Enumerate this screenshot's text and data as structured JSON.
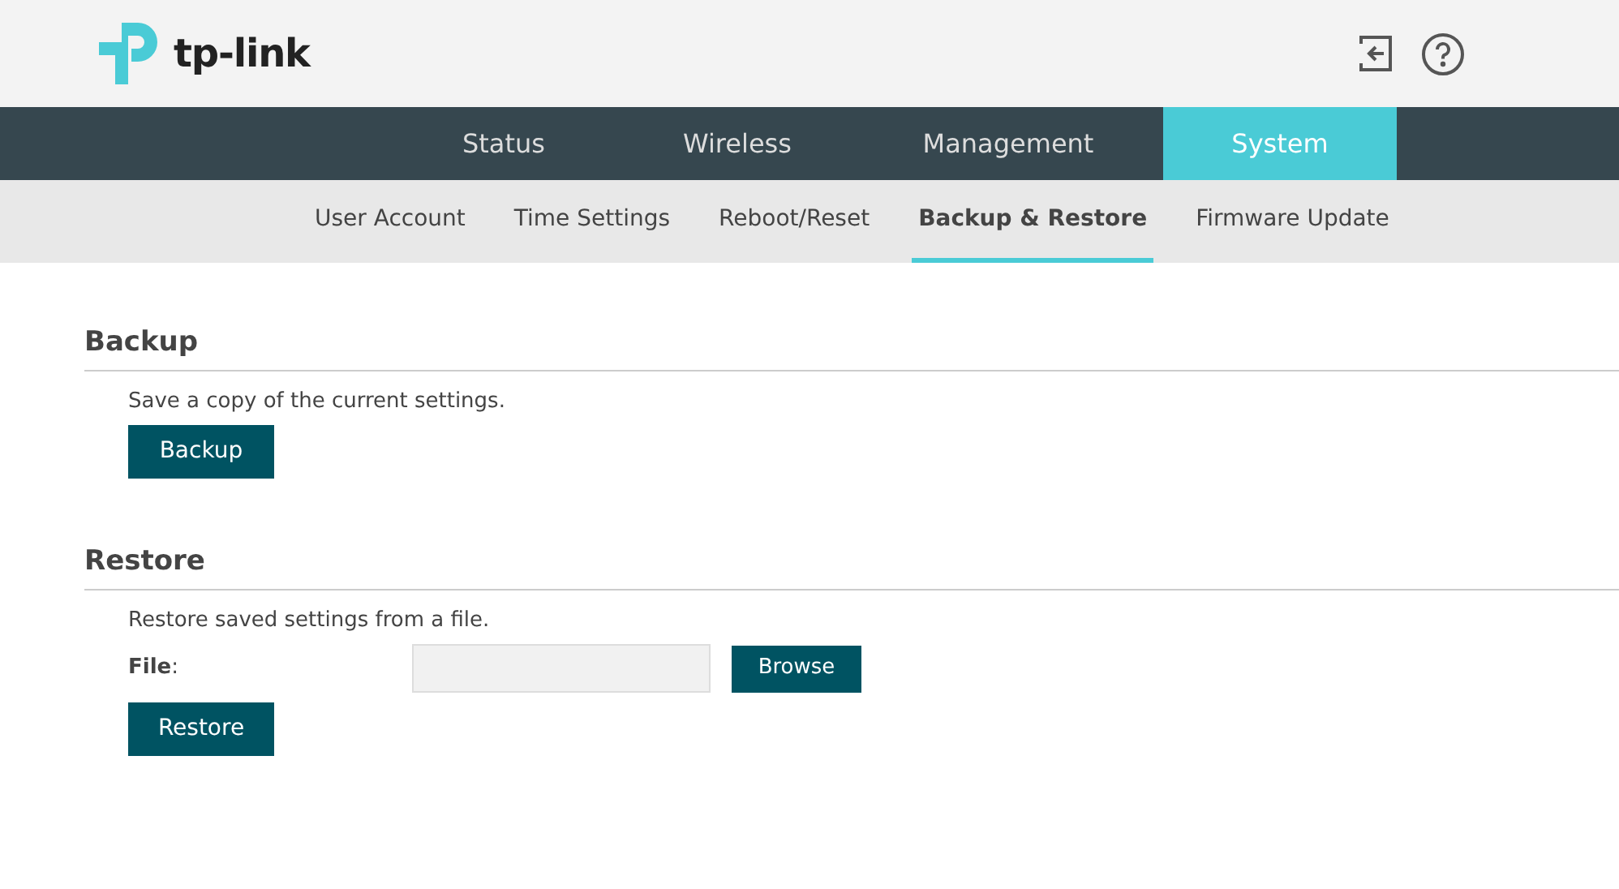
{
  "header": {
    "logo_text": "tp-link"
  },
  "main_nav": [
    {
      "label": "Status",
      "selected": false
    },
    {
      "label": "Wireless",
      "selected": false
    },
    {
      "label": "Management",
      "selected": false
    },
    {
      "label": "System",
      "selected": true
    }
  ],
  "sub_nav": [
    {
      "label": "User Account",
      "selected": false
    },
    {
      "label": "Time Settings",
      "selected": false
    },
    {
      "label": "Reboot/Reset",
      "selected": false
    },
    {
      "label": "Backup & Restore",
      "selected": true
    },
    {
      "label": "Firmware Update",
      "selected": false
    }
  ],
  "backup": {
    "title": "Backup",
    "description": "Save a copy of the current settings.",
    "button": "Backup"
  },
  "restore": {
    "title": "Restore",
    "description": "Restore saved settings from a file.",
    "file_label": "**File**:",
    "browse_button": "Browse",
    "button": "Restore"
  }
}
